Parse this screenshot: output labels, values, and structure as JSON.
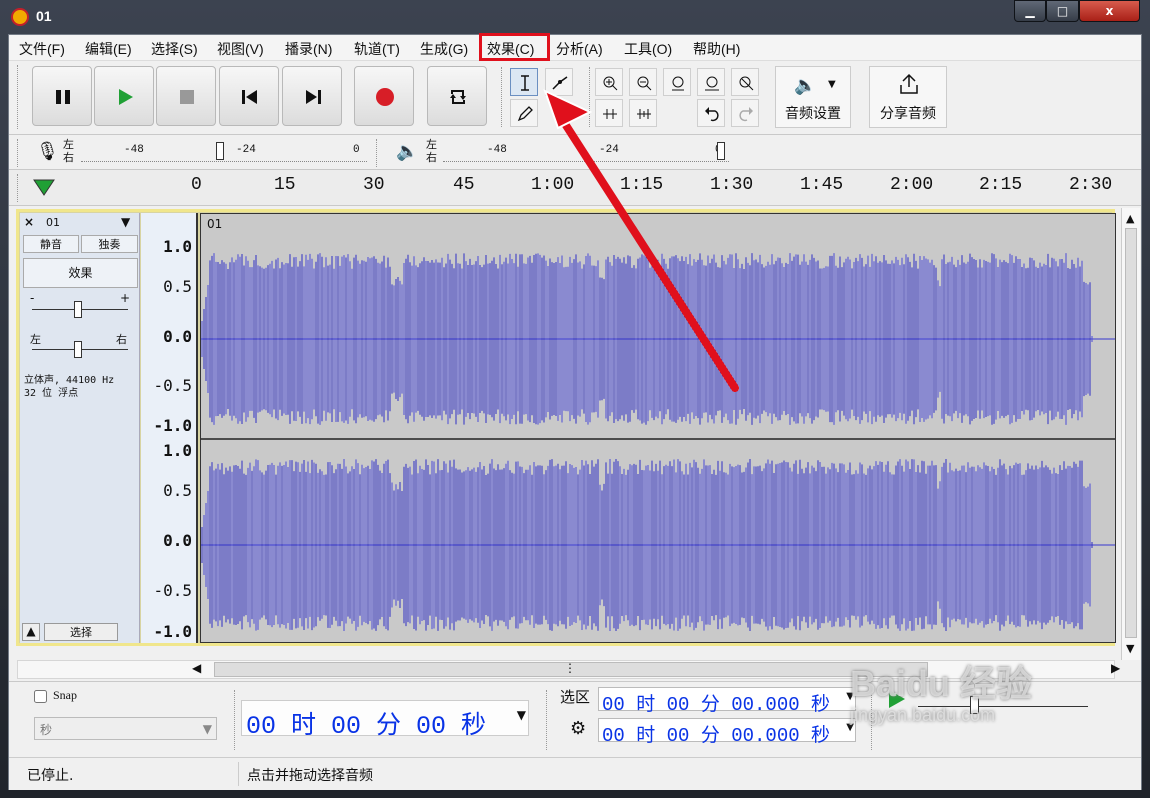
{
  "window": {
    "title": "01",
    "minimize": "▁",
    "maximize": "□",
    "close": "x"
  },
  "menubar": [
    "文件(F)",
    "编辑(E)",
    "选择(S)",
    "视图(V)",
    "播录(N)",
    "轨道(T)",
    "生成(G)",
    "效果(C)",
    "分析(A)",
    "工具(O)",
    "帮助(H)"
  ],
  "toolbar": {
    "audio_settings": "音频设置",
    "share_audio": "分享音频",
    "speaker_arrow": "▼"
  },
  "meters": {
    "record_lr": "左\n右",
    "play_lr": "左\n右",
    "record_ticks": [
      "-48",
      "-24",
      "0"
    ],
    "play_ticks": [
      "-48",
      "-24",
      "0"
    ]
  },
  "timeline": {
    "ticks": [
      "0",
      "15",
      "30",
      "45",
      "1:00",
      "1:15",
      "1:30",
      "1:45",
      "2:00",
      "2:15",
      "2:30"
    ]
  },
  "track": {
    "name": "01",
    "mute": "静音",
    "solo": "独奏",
    "effects": "效果",
    "gain_minus": "-",
    "gain_plus": "+",
    "pan_left": "左",
    "pan_right": "右",
    "info_line1": "立体声, 44100 Hz",
    "info_line2": "32 位 浮点",
    "select": "选择",
    "clip_title": "01",
    "amp_labels": [
      "1.0",
      "0.5",
      "0.0",
      "-0.5",
      "-1.0"
    ]
  },
  "bottom": {
    "snap": "Snap",
    "snap_unit": "秒",
    "position": "00 时 00 分 00 秒",
    "selection_label": "选区",
    "selection_start": "00 时 00 分 00.000 秒",
    "selection_end": "00 时 00 分 00.000 秒"
  },
  "status": {
    "left": "已停止.",
    "hint": "点击并拖动选择音频"
  },
  "watermark": {
    "logo": "Baidu 经验",
    "url": "jingyan.baidu.com"
  },
  "colors": {
    "waveform": "#3737cf",
    "highlight": "#e0101c",
    "time_digits": "#0933e6"
  }
}
